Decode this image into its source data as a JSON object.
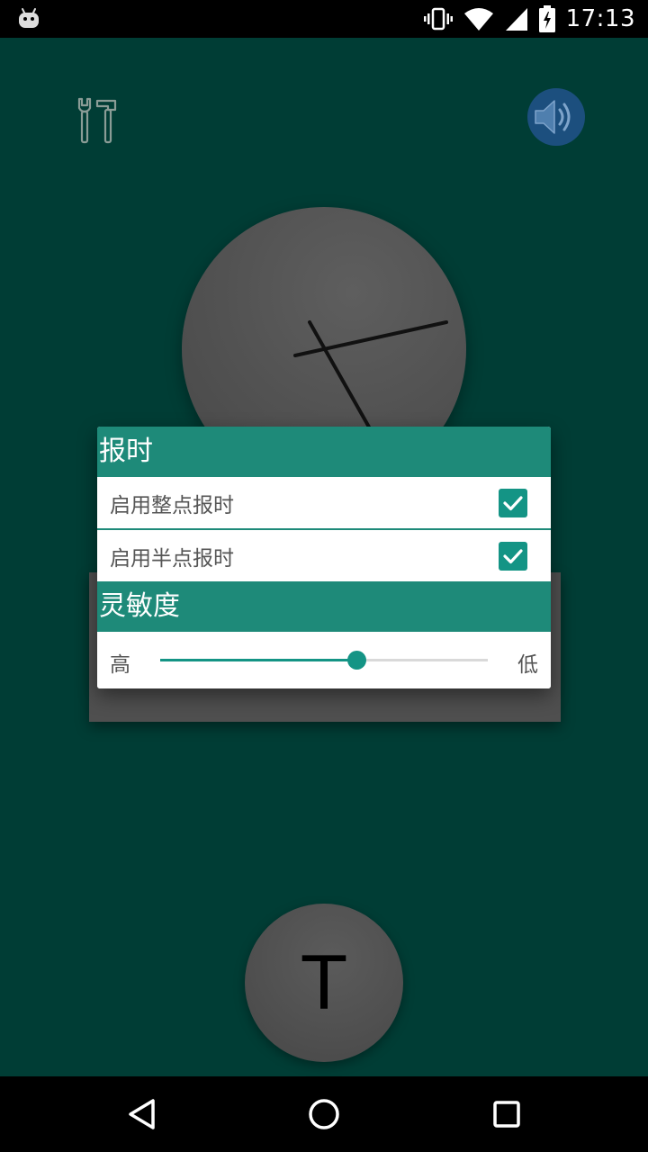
{
  "status_bar": {
    "time": "17:13",
    "icons": [
      "android-debug-icon",
      "vibrate-icon",
      "wifi-icon",
      "signal-icon",
      "battery-charging-icon"
    ]
  },
  "toolbar": {
    "tools_icon": "tools-icon",
    "speaker_icon": "speaker-icon"
  },
  "clock": {
    "hour_hand_icon": "hour-hand",
    "minute_hand_icon": "minute-hand"
  },
  "dialog": {
    "chime_header": "报时",
    "hourly_chime_label": "启用整点报时",
    "hourly_chime_checked": true,
    "half_hour_chime_label": "启用半点报时",
    "half_hour_chime_checked": true,
    "sensitivity_header": "灵敏度",
    "slider_high_label": "高",
    "slider_low_label": "低",
    "sensitivity_value": 0.6
  },
  "t_button": {
    "label": "T"
  },
  "colors": {
    "background": "#003d35",
    "accent": "#1e8a79",
    "checkbox": "#149485",
    "speaker_bg": "#1c4f7e"
  },
  "nav_bar": {
    "icons": [
      "back-icon",
      "home-icon",
      "recent-apps-icon"
    ]
  }
}
